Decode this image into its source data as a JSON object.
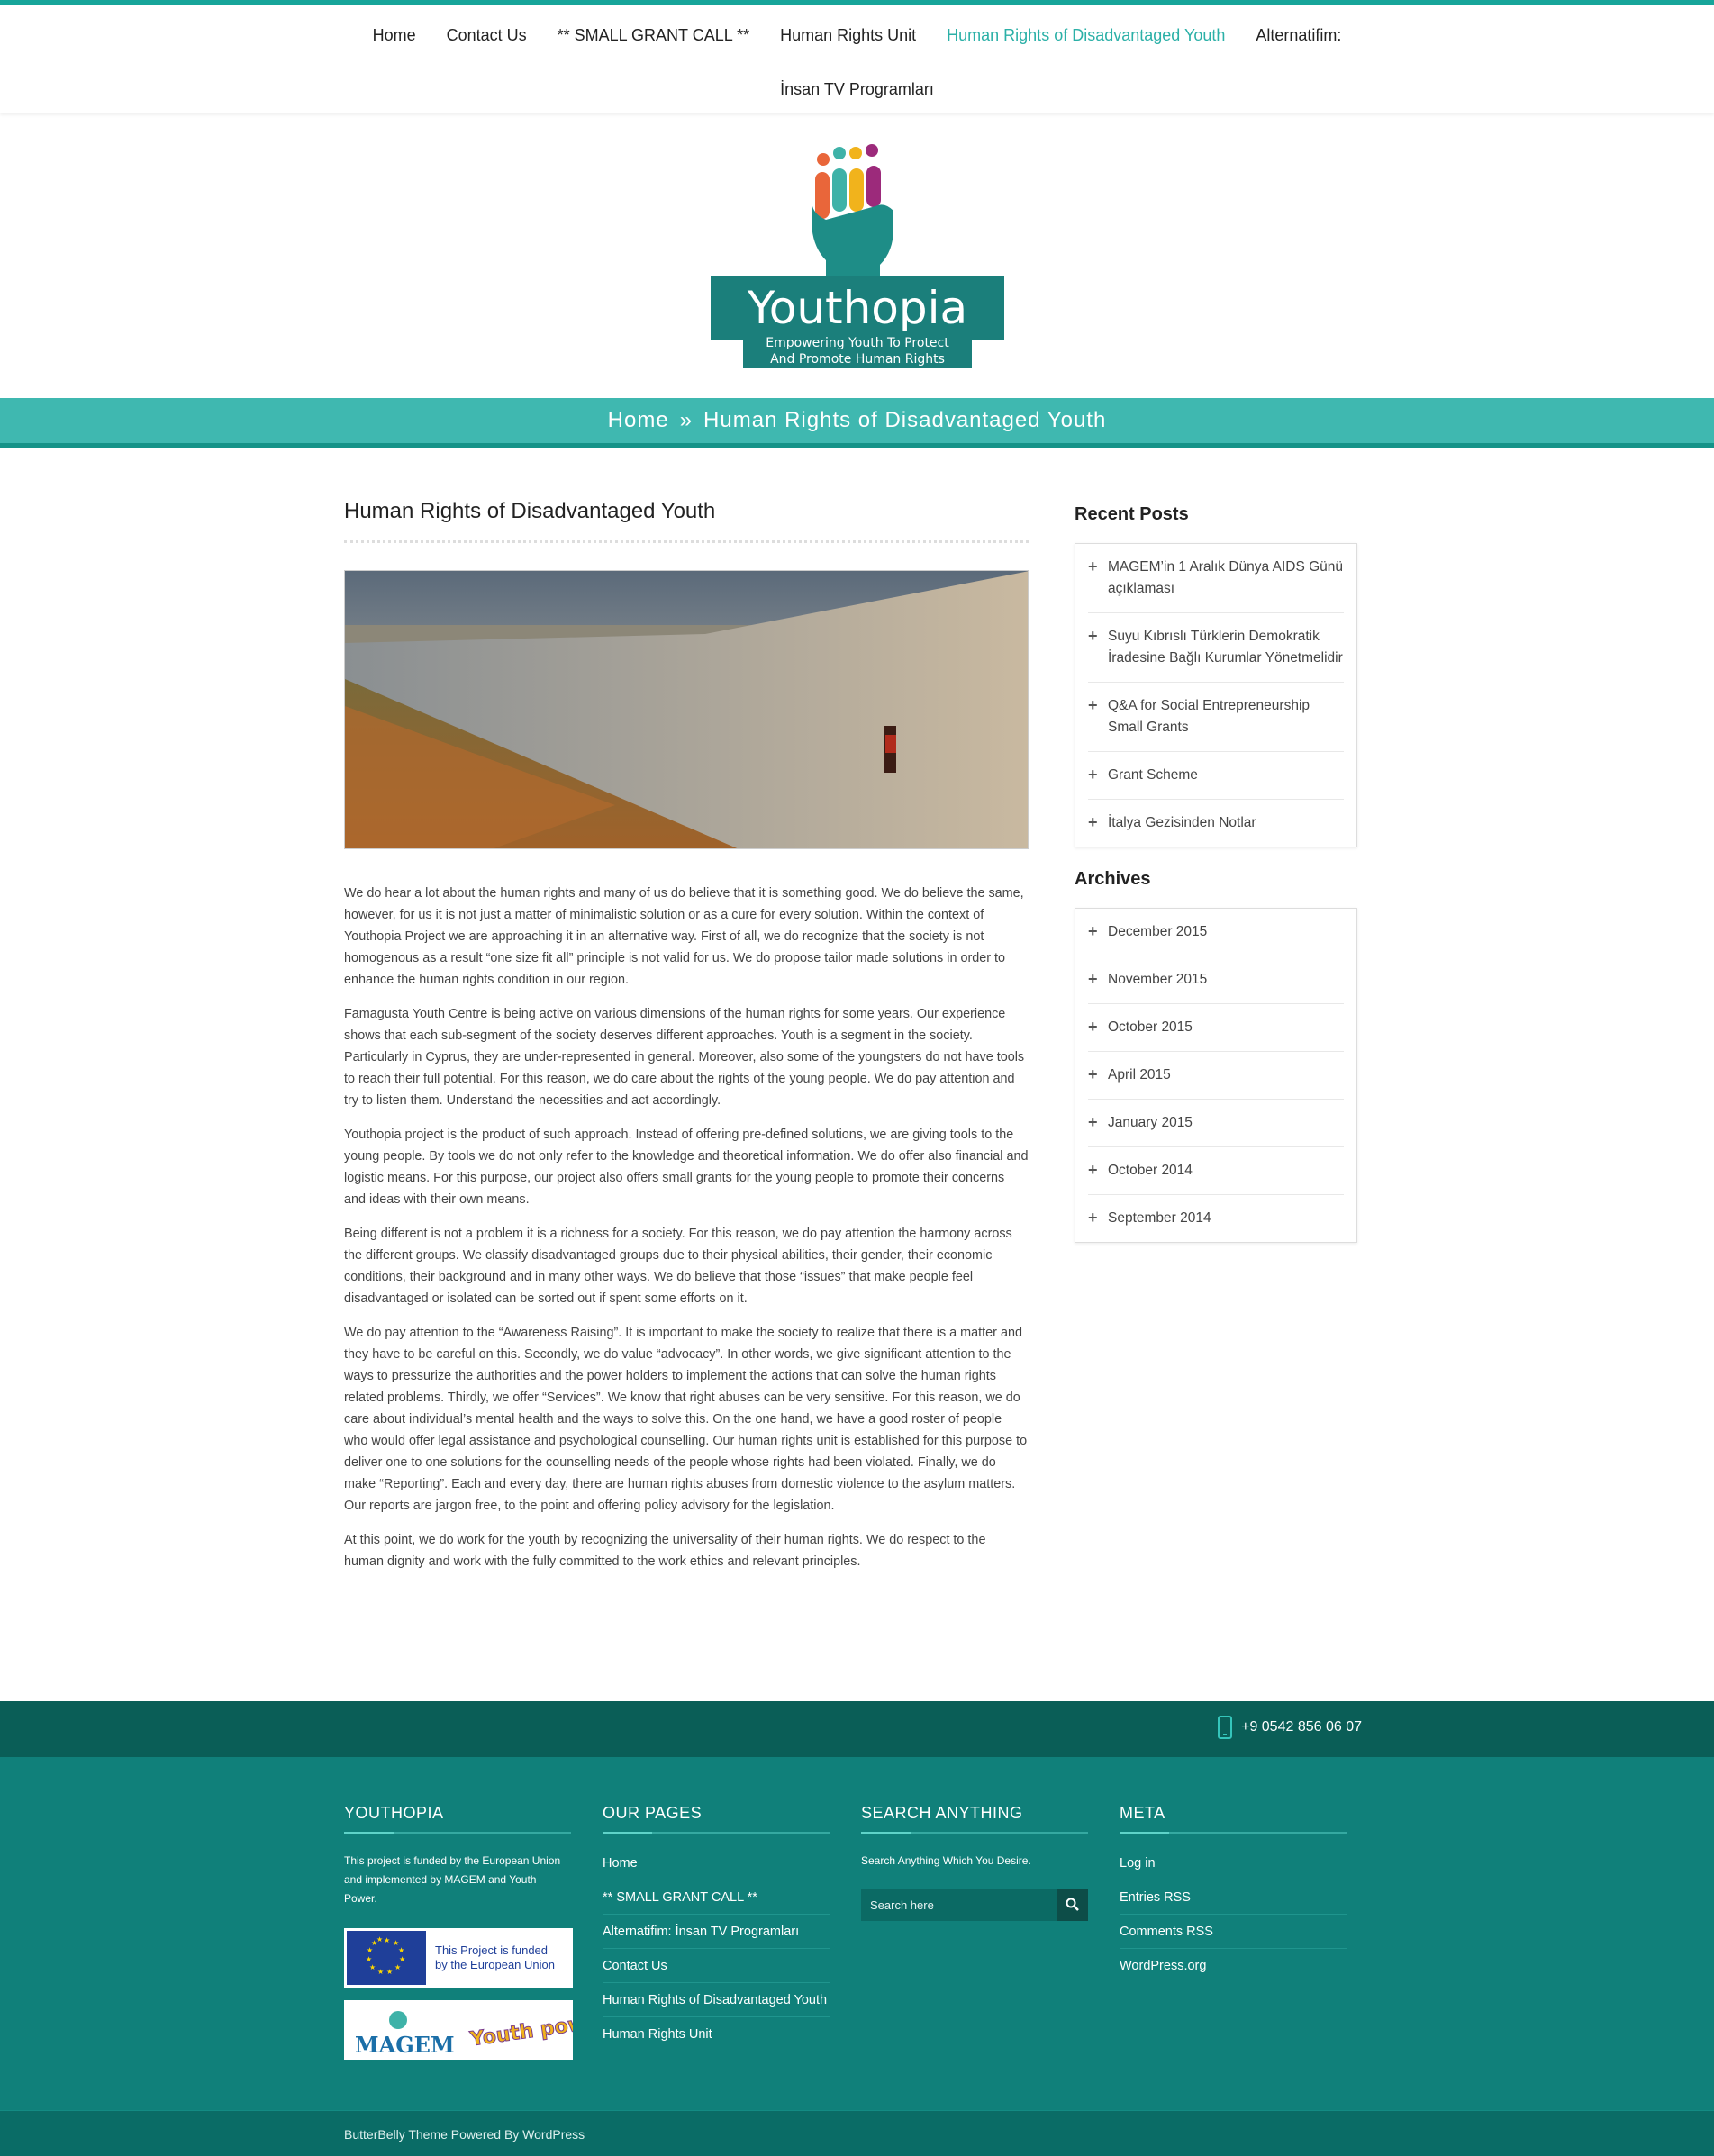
{
  "nav": {
    "items": [
      "Home",
      "Contact Us",
      "** SMALL GRANT CALL **",
      "Human Rights Unit",
      "Human Rights of Disadvantaged Youth",
      "Alternatifim:"
    ],
    "second_row": "İnsan TV Programları",
    "active_index": 4
  },
  "logo": {
    "name": "Youthopia",
    "tagline_1": "Empowering Youth To Protect",
    "tagline_2": "And Promote Human Rights"
  },
  "breadcrumb": {
    "home": "Home",
    "sep": "»",
    "current": "Human Rights of Disadvantaged Youth"
  },
  "article": {
    "title": "Human Rights of Disadvantaged Youth",
    "paragraphs": [
      "We do hear a lot about the human rights and many of us do believe that it is something good. We do believe the same, however, for us it is not just a matter of minimalistic solution or as a cure for every solution. Within the context of Youthopia Project we are approaching it in an alternative way. First of all, we do recognize that the society is not homogenous as a result “one size fit all” principle is not valid for us. We do propose tailor made solutions in order to enhance the human rights condition in our region.",
      "Famagusta Youth Centre is being active on various dimensions of the human rights for some years. Our experience shows that each sub-segment of the society deserves different approaches. Youth is a segment in the society. Particularly in Cyprus, they are under-represented in general. Moreover, also some of the youngsters do not have tools to reach their full potential. For this reason, we do care about the rights of the young people. We do pay attention and try to listen them. Understand the necessities and act accordingly.",
      "Youthopia project is the product of such approach. Instead of offering pre-defined solutions, we are giving tools to the young people. By tools we do not only refer to the knowledge and theoretical information. We do offer also financial and logistic means. For this purpose, our project also offers small grants for the young people to promote their concerns and ideas with their own means.",
      "Being different is not a problem it is a richness for a society. For this reason, we do pay attention the harmony across the different groups. We classify disadvantaged groups due to their physical abilities, their gender, their economic conditions, their background and in many other ways. We do believe that those “issues” that make people feel disadvantaged or isolated can be sorted out if spent some efforts on it.",
      "We do pay attention to the “Awareness Raising”. It is important to make the society to realize that there is a matter and they have to be careful on this. Secondly, we do value “advocacy”. In other words, we give significant attention to the ways to pressurize the authorities and the power holders to implement the actions that can solve the human rights related problems. Thirdly, we offer “Services”. We know that right abuses can be very sensitive. For this reason, we do care about individual’s mental health and the ways to solve this. On the one hand, we have a good roster of people who would offer legal assistance and psychological counselling. Our human rights unit is established for this purpose to deliver one to one solutions for the counselling needs of the people whose rights had been violated. Finally, we do make “Reporting”. Each and every day, there are human rights abuses from domestic violence to the asylum matters. Our reports are jargon free, to the point and offering policy advisory for the legislation.",
      "At this point, we do work for the youth by recognizing the universality of their human rights. We do respect to the human dignity and work with the fully committed to the work ethics and relevant principles."
    ]
  },
  "sidebar": {
    "recent_title": "Recent Posts",
    "recent": [
      "MAGEM’in 1 Aralık Dünya AIDS Günü açıklaması",
      "Suyu Kıbrıslı Türklerin Demokratik İradesine Bağlı Kurumlar Yönetmelidir",
      "Q&A for Social Entrepreneurship Small Grants",
      "Grant Scheme",
      "İtalya Gezisinden Notlar"
    ],
    "archives_title": "Archives",
    "archives": [
      "December 2015",
      "November 2015",
      "October 2015",
      "April 2015",
      "January 2015",
      "October 2014",
      "September 2014"
    ]
  },
  "footer": {
    "phone": "+9 0542 856 06 07",
    "col1": {
      "title": "YOUTHOPIA",
      "text": "This project is funded by the European Union and implemented by MAGEM and Youth Power.",
      "eu_text_1": "This Project is funded",
      "eu_text_2": "by the European Union",
      "magem": "MAGEM",
      "youthpower": "Youth power"
    },
    "col2": {
      "title": "OUR PAGES",
      "links": [
        "Home",
        "** SMALL GRANT CALL **",
        "Alternatifim: İnsan TV Programları",
        "Contact Us",
        "Human Rights of Disadvantaged Youth",
        "Human Rights Unit"
      ]
    },
    "col3": {
      "title": "SEARCH ANYTHING",
      "text": "Search Anything Which You Desire.",
      "placeholder": "Search here"
    },
    "col4": {
      "title": "META",
      "links": [
        "Log in",
        "Entries RSS",
        "Comments RSS",
        "WordPress.org"
      ]
    },
    "credit": "ButterBelly Theme Powered By WordPress"
  },
  "colors": {
    "accent": "#17a59a",
    "band": "#3fb8b0",
    "footer": "#10807a",
    "footer_dark": "#0a5e57",
    "active_nav": "#2bb0a7"
  }
}
